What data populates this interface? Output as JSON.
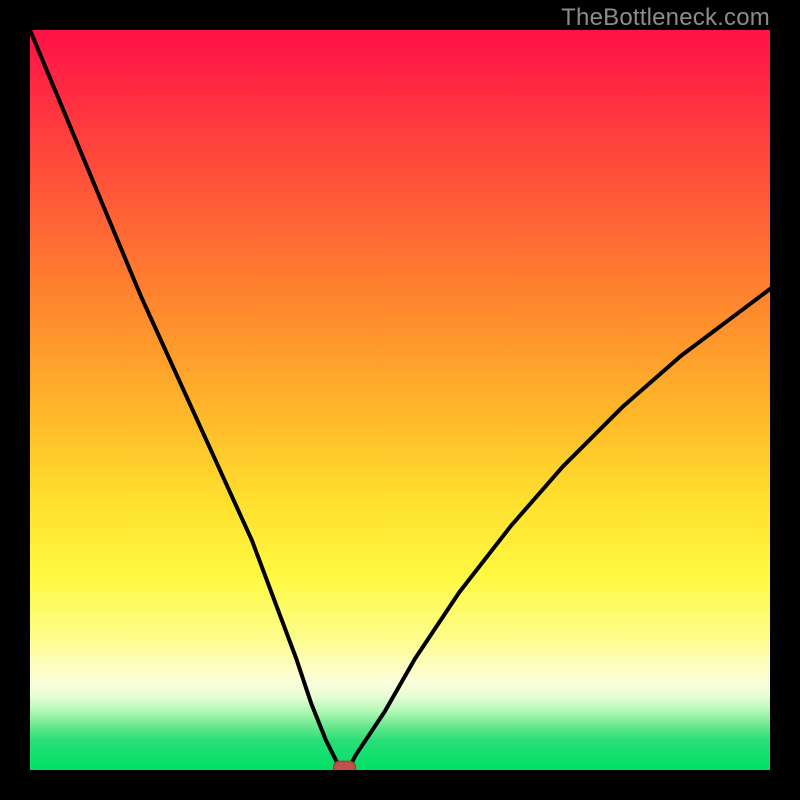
{
  "watermark": "TheBottleneck.com",
  "colors": {
    "frame": "#000000",
    "gradient_top": "#ff1146",
    "gradient_mid": "#ffe12e",
    "gradient_bottom": "#00e066",
    "curve": "#000000",
    "marker": "#c0504c"
  },
  "chart_data": {
    "type": "line",
    "title": "",
    "xlabel": "",
    "ylabel": "",
    "xlim": [
      0,
      100
    ],
    "ylim": [
      0,
      100
    ],
    "x": [
      0,
      5,
      10,
      15,
      20,
      25,
      30,
      33,
      36,
      38,
      40,
      41,
      42,
      43,
      44,
      48,
      52,
      58,
      65,
      72,
      80,
      88,
      96,
      100
    ],
    "values": [
      100,
      88,
      76,
      64,
      53,
      42,
      31,
      23,
      15,
      9,
      4,
      2,
      0,
      0,
      2,
      8,
      15,
      24,
      33,
      41,
      49,
      56,
      62,
      65
    ],
    "marker": {
      "x": 42.5,
      "y": 0
    },
    "grid": false,
    "legend": false
  }
}
